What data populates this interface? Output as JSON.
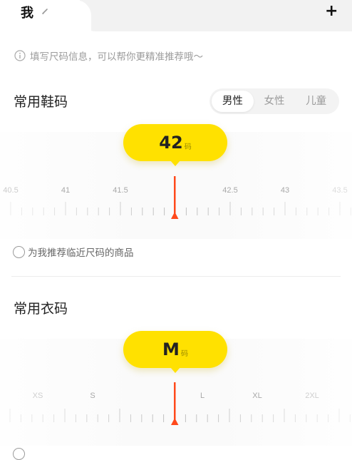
{
  "header": {
    "title": "我",
    "plus": "+"
  },
  "info": {
    "text": "填写尺码信息，可以帮你更精准推荐哦～"
  },
  "shoe": {
    "section_title": "常用鞋码",
    "gender_options": [
      "男性",
      "女性",
      "儿童"
    ],
    "selected_gender": "男性",
    "selected_value": "42",
    "unit": "码",
    "tick_labels": [
      "40.5",
      "41",
      "41.5",
      "42.5",
      "43",
      "43.5"
    ],
    "recommend_label": "为我推荐临近尺码的商品"
  },
  "clothing": {
    "section_title": "常用衣码",
    "selected_value": "M",
    "unit": "码",
    "tick_labels": [
      "XS",
      "S",
      "L",
      "XL",
      "2XL"
    ]
  },
  "colors": {
    "accent": "#ffe100",
    "pointer": "#ff4a1c"
  }
}
